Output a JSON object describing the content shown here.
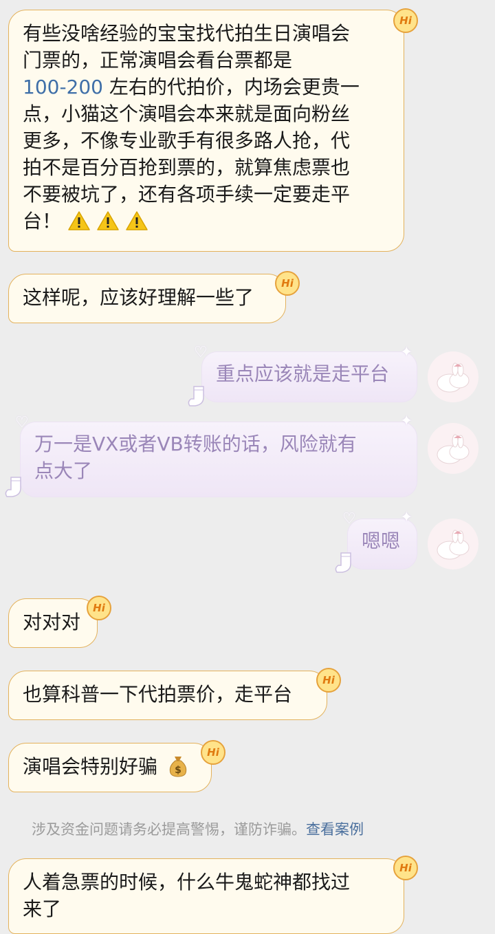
{
  "messages": {
    "m1": {
      "line1": "有些没啥经验的宝宝找代拍生日演唱会",
      "line2": "门票的，正常演唱会看台票都是",
      "line3_num": "100-200",
      "line3_text": "左右的代拍价，内场会更贵一",
      "line4": "点，小猫这个演唱会本来就是面向粉丝",
      "line5": "更多，不像专业歌手有很多路人抢，代",
      "line6": "拍不是百分百抢到票的，就算焦虑票也",
      "line7": "不要被坑了，还有各项手续一定要走平",
      "line8": "台！",
      "emoji": "warning-icon x3"
    },
    "m2": "这样呢，应该好理解一些了",
    "m3": "重点应该就是走平台",
    "m4_line1": "万一是VX或者VB转账的话，风险就有",
    "m4_line2": "点大了",
    "m5": "嗯嗯",
    "m6": "对对对",
    "m7": "也算科普一下代拍票价，走平台",
    "m8": "演唱会特别好骗",
    "m9_line1": "人着急票的时候，什么牛鬼蛇神都找过",
    "m9_line2": "来了"
  },
  "badge": "Hi",
  "notice": {
    "text": "涉及资金问题请务必提高警惕，谨防诈骗。",
    "link": "查看案例"
  },
  "colors": {
    "background": "#ededed",
    "left_bubble": "#fffbee",
    "left_border": "#e3b15b",
    "right_bubble": "#f3ecf9",
    "right_text": "#9a86b8",
    "link": "#4a6f9d"
  }
}
